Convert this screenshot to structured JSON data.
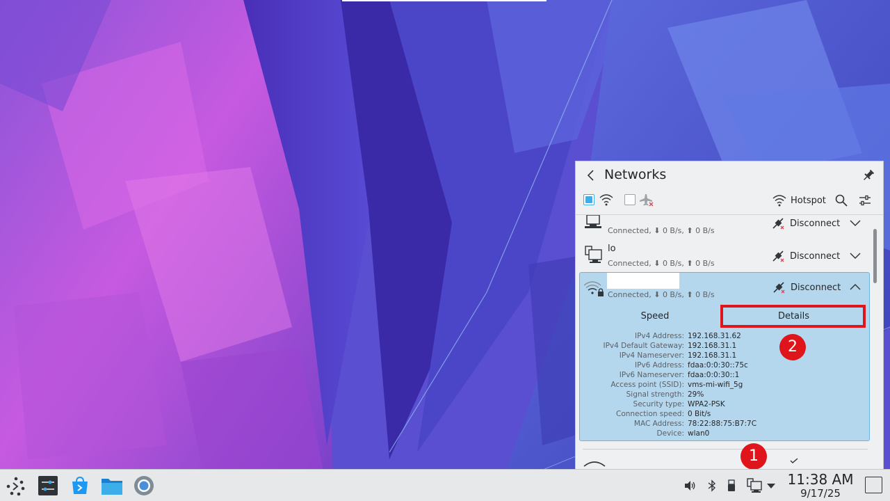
{
  "popup": {
    "title": "Networks",
    "hotspot_label": "Hotspot",
    "connections": [
      {
        "name": "",
        "status": "Connected, ⬇ 0 B/s, ⬆ 0 B/s",
        "action": "Disconnect"
      },
      {
        "name": "lo",
        "status": "Connected, ⬇ 0 B/s, ⬆ 0 B/s",
        "action": "Disconnect"
      },
      {
        "name": "",
        "status": "Connected, ⬇ 0 B/s, ⬆ 0 B/s",
        "action": "Disconnect"
      }
    ],
    "tabs": {
      "speed": "Speed",
      "details": "Details"
    },
    "details": [
      {
        "label": "IPv4 Address:",
        "value": "192.168.31.62"
      },
      {
        "label": "IPv4 Default Gateway:",
        "value": "192.168.31.1"
      },
      {
        "label": "IPv4 Nameserver:",
        "value": "192.168.31.1"
      },
      {
        "label": "IPv6 Address:",
        "value": "fdaa:0:0:30::75c"
      },
      {
        "label": "IPv6 Nameserver:",
        "value": "fdaa:0:0:30::1"
      },
      {
        "label": "Access point (SSID):",
        "value": "vms-mi-wifi_5g"
      },
      {
        "label": "Signal strength:",
        "value": "29%"
      },
      {
        "label": "Security type:",
        "value": "WPA2-PSK"
      },
      {
        "label": "Connection speed:",
        "value": "0 Bit/s"
      },
      {
        "label": "MAC Address:",
        "value": "78:22:88:75:B7:7C"
      },
      {
        "label": "Device:",
        "value": "wlan0"
      }
    ]
  },
  "annotations": {
    "first": "1",
    "second": "2"
  },
  "clock": {
    "time": "11:38 AM",
    "date": "9/17/25"
  },
  "colors": {
    "accent": "#3daee9",
    "annotation": "#e0151b",
    "selected_bg": "#b5d7ee"
  }
}
